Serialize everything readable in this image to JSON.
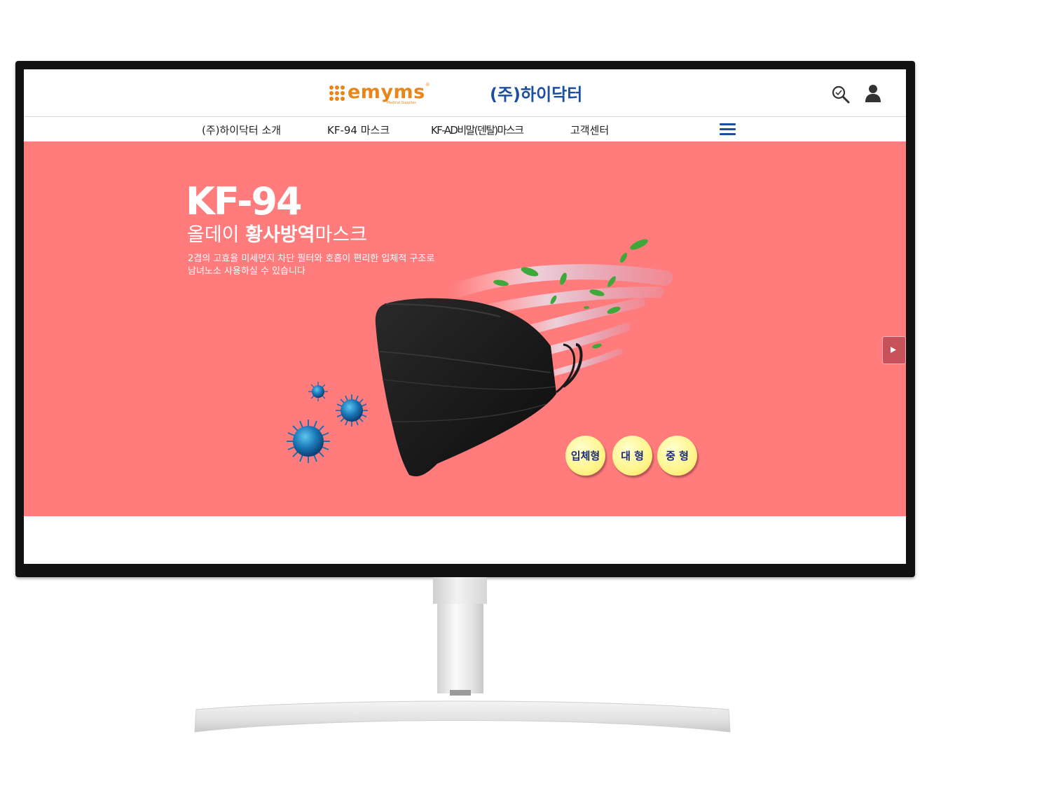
{
  "header": {
    "logo_text": "emyms",
    "logo_sub": "Medical Supplies",
    "company_name": "(주)하이닥터",
    "icons": [
      "search-icon",
      "user-icon"
    ]
  },
  "nav": {
    "items": [
      {
        "label": "(주)하이닥터 소개"
      },
      {
        "label": "KF-94 마스크"
      },
      {
        "label": "KF-AD비말(덴탈)마스크"
      },
      {
        "label": "고객센터"
      }
    ],
    "menu_icon": "hamburger-icon"
  },
  "hero": {
    "title": "KF-94",
    "subtitle_normal_1": "올데이 ",
    "subtitle_bold": "황사방역",
    "subtitle_normal_2": "마스크",
    "desc_line1": "2겹의 고효율 미세먼지 차단 필터와 호흡이 편리한 입체적 구조로",
    "desc_line2": "남녀노소 사용하실 수 있습니다",
    "badges": [
      "입체형",
      "대 형",
      "중 형"
    ],
    "background_color": "#ff7b7c",
    "next_icon": "play-arrow-icon"
  },
  "colors": {
    "brand_orange": "#e8861a",
    "brand_blue": "#1d4fa0",
    "badge_yellow": "#fff58a"
  }
}
